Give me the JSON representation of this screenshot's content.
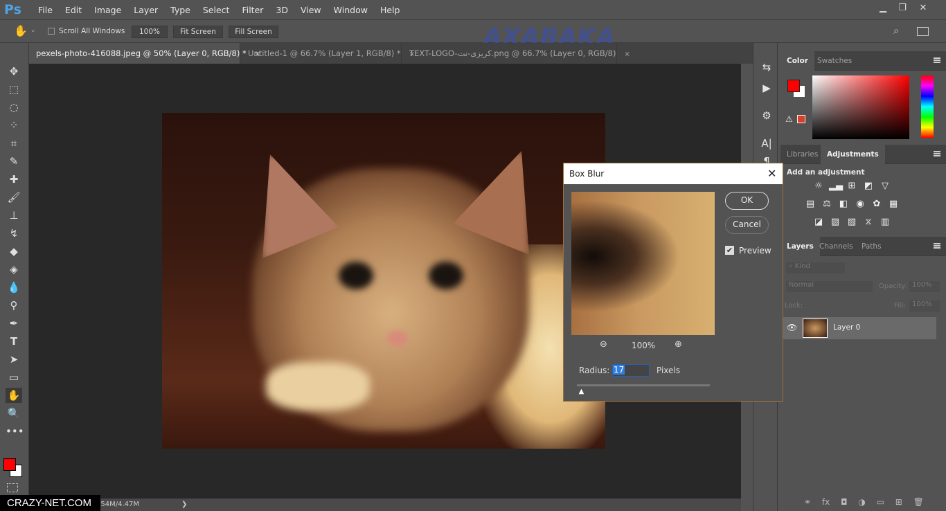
{
  "app": {
    "logo": "Ps"
  },
  "menu": [
    "File",
    "Edit",
    "Image",
    "Layer",
    "Type",
    "Select",
    "Filter",
    "3D",
    "View",
    "Window",
    "Help"
  ],
  "options": {
    "scroll_all_windows": "Scroll All Windows",
    "zoom_100": "100%",
    "fit_screen": "Fit Screen",
    "fill_screen": "Fill Screen",
    "scroll_all_checked": false
  },
  "watermark": "AXABAKA",
  "tabs": [
    {
      "label": "pexels-photo-416088.jpeg @ 50% (Layer 0, RGB/8) *",
      "active": true
    },
    {
      "label": "Untitled-1 @ 66.7% (Layer 1, RGB/8) *",
      "active": false
    },
    {
      "label": "TEXT-LOGO-کریزی-نت.png @ 66.7% (Layer 0, RGB/8)",
      "active": false
    }
  ],
  "tab_close": "×",
  "status": {
    "doc": "Doc: 3.54M/4.47M",
    "arrow": "❯",
    "site": "CRAZY-NET.COM"
  },
  "colors": {
    "foreground": "#ff0000",
    "background": "#ffffff",
    "accent": "#1a73e8"
  },
  "color_panel": {
    "tabs": [
      "Color",
      "Swatches"
    ]
  },
  "adjust_panel": {
    "tabs": [
      "Libraries",
      "Adjustments"
    ],
    "heading": "Add an adjustment"
  },
  "layers_panel": {
    "tabs": [
      "Layers",
      "Channels",
      "Paths"
    ],
    "filter": "Kind",
    "blend_mode": "Normal",
    "opacity_label": "Opacity:",
    "opacity": "100%",
    "lock_label": "Lock:",
    "fill_label": "Fill:",
    "fill": "100%",
    "layers": [
      {
        "name": "Layer 0",
        "visible": true
      }
    ]
  },
  "dialog": {
    "title": "Box Blur",
    "ok": "OK",
    "cancel": "Cancel",
    "preview_label": "Preview",
    "preview_checked": true,
    "zoom": "100%",
    "radius_label": "Radius:",
    "radius": "17",
    "units": "Pixels",
    "slider_fraction": 0.04
  }
}
